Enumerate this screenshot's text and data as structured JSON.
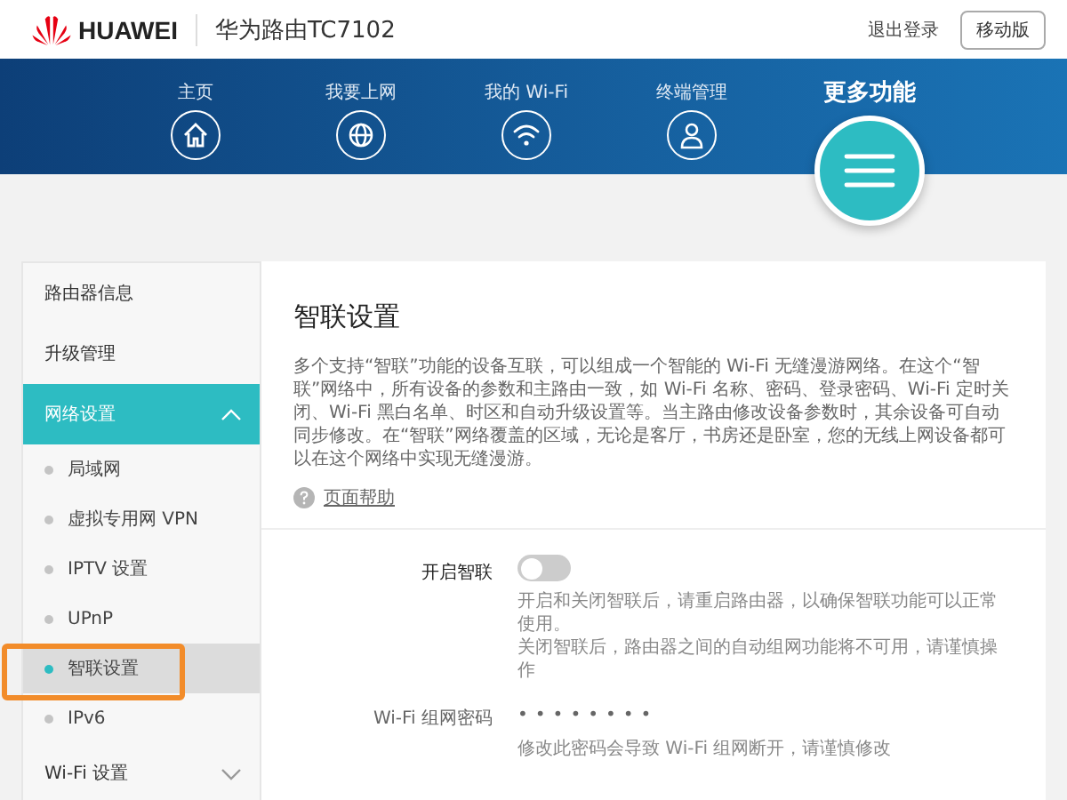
{
  "header": {
    "brand": "HUAWEI",
    "product": "华为路由TC7102",
    "logout": "退出登录",
    "mobile_button": "移动版"
  },
  "nav": [
    {
      "label": "主页",
      "selected": false
    },
    {
      "label": "我要上网",
      "selected": false
    },
    {
      "label": "我的 Wi-Fi",
      "selected": false
    },
    {
      "label": "终端管理",
      "selected": false
    },
    {
      "label": "更多功能",
      "selected": true
    }
  ],
  "sidebar": [
    {
      "label": "路由器信息",
      "selected": false
    },
    {
      "label": "升级管理",
      "selected": false
    },
    {
      "label": "网络设置",
      "selected": true,
      "expanded": true,
      "children": [
        {
          "label": "局域网",
          "selected": false
        },
        {
          "label": "虚拟专用网 VPN",
          "selected": false
        },
        {
          "label": "IPTV 设置",
          "selected": false
        },
        {
          "label": "UPnP",
          "selected": false
        },
        {
          "label": "智联设置",
          "selected": true
        },
        {
          "label": "IPv6",
          "selected": false
        }
      ]
    },
    {
      "label": "Wi-Fi 设置",
      "selected": false,
      "expanded": false
    }
  ],
  "content": {
    "title": "智联设置",
    "description": "多个支持“智联”功能的设备互联，可以组成一个智能的 Wi-Fi 无缝漫游网络。在这个“智联”网络中，所有设备的参数和主路由一致，如 Wi-Fi 名称、密码、登录密码、Wi-Fi 定时关闭、Wi-Fi 黑白名单、时区和自动升级设置等。当主路由修改设备参数时，其余设备可自动同步修改。在“智联”网络覆盖的区域，无论是客厅，书房还是卧室，您的无线上网设备都可以在这个网络中实现无缝漫游。",
    "help_link": "页面帮助",
    "settings": [
      {
        "kind": "toggle",
        "label": "开启智联",
        "on": false,
        "hints": [
          "开启和关闭智联后，请重启路由器，以确保智联功能可以正常使用。",
          "关闭智联后，路由器之间的自动组网功能将不可用，请谨慎操作"
        ]
      },
      {
        "kind": "password",
        "label": "Wi-Fi 组网密码",
        "value": "••••••••",
        "hints": [
          "修改此密码会导致 Wi-Fi 组网断开，请谨慎修改"
        ]
      }
    ]
  }
}
